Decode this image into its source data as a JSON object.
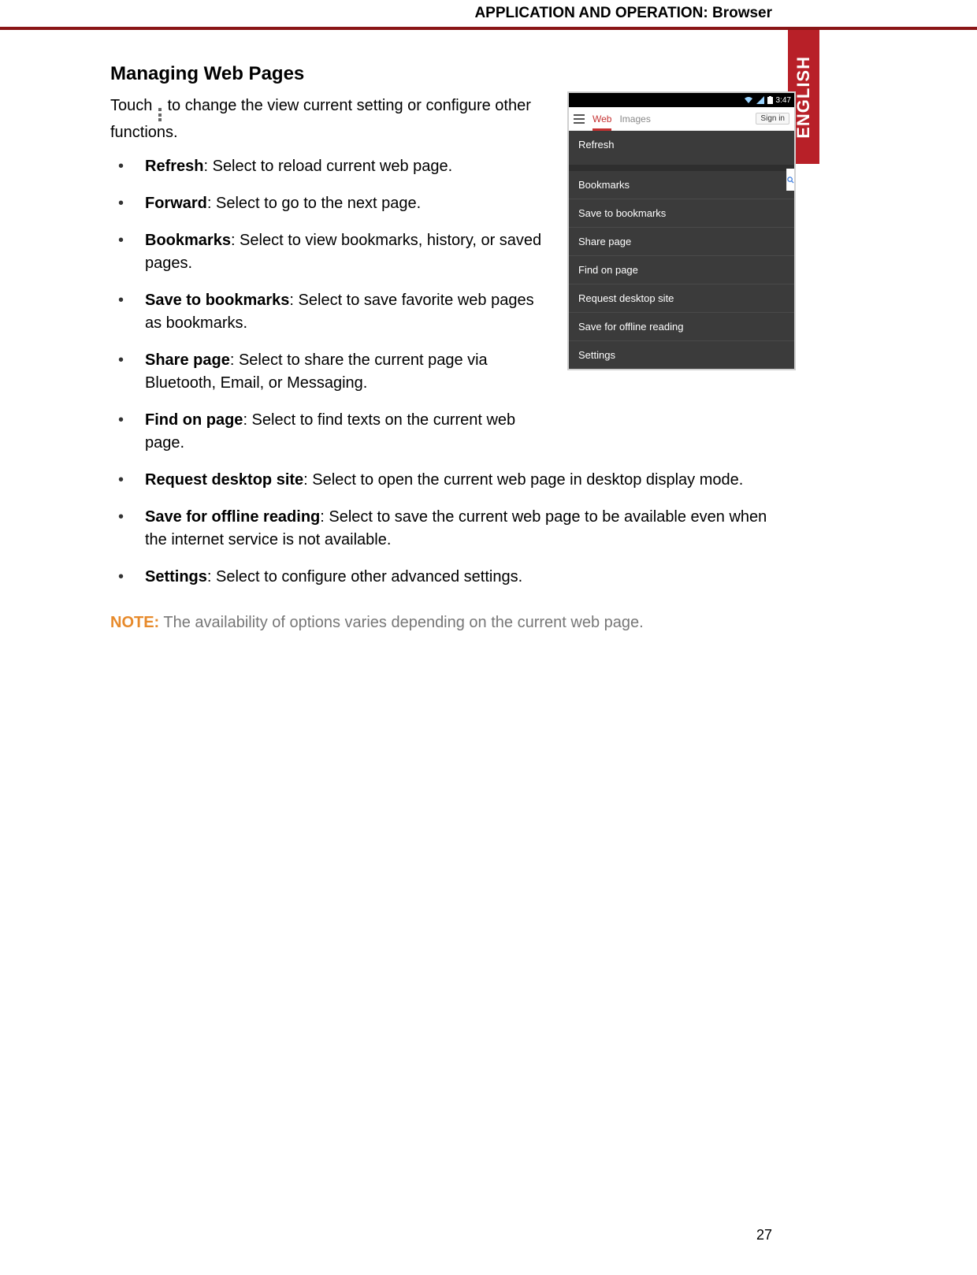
{
  "header": {
    "title": "APPLICATION AND OPERATION: Browser"
  },
  "language_tab": "ENGLISH",
  "page_number": "27",
  "section": {
    "heading": "Managing Web Pages",
    "intro_before": "Touch ",
    "intro_after": " to change the view current setting or configure other functions.",
    "items": [
      {
        "term": "Refresh",
        "desc": ": Select to reload current web page."
      },
      {
        "term": "Forward",
        "desc": ": Select to go to the next page."
      },
      {
        "term": "Bookmarks",
        "desc": ": Select to view bookmarks, history, or saved pages."
      },
      {
        "term": "Save to bookmarks",
        "desc": ": Select to save favorite web pages as bookmarks."
      },
      {
        "term": "Share page",
        "desc": ": Select to share the current page via Bluetooth, Email, or Messaging."
      },
      {
        "term": "Find on page",
        "desc": ": Select to find texts on the current web page."
      },
      {
        "term": "Request desktop site",
        "desc": ": Select to open the current web page in desktop display mode."
      },
      {
        "term": "Save for offline reading",
        "desc": ": Select to save the current web page to be available even when the internet service is not available."
      },
      {
        "term": "Settings",
        "desc": ": Select to configure other advanced settings."
      }
    ],
    "note": {
      "label": "NOTE:",
      "text": " The availability of options varies depending on the current web page."
    }
  },
  "figure": {
    "status_time": "3:47",
    "tabs": {
      "web": "Web",
      "images": "Images"
    },
    "signin": "Sign in",
    "menu": [
      "Refresh",
      "Bookmarks",
      "Save to bookmarks",
      "Share page",
      "Find on page",
      "Request desktop site",
      "Save for offline reading",
      "Settings"
    ]
  }
}
